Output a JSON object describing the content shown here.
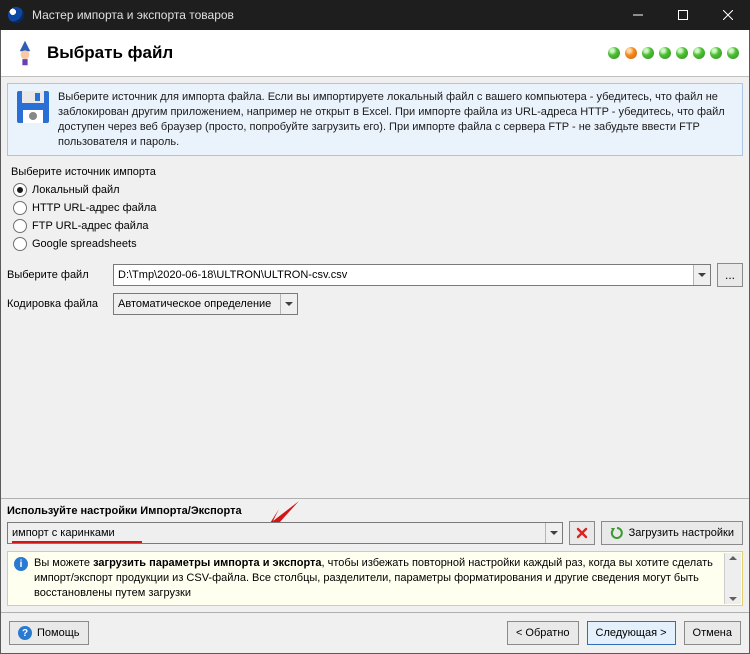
{
  "titlebar": {
    "title": "Мастер импорта и экспорта товаров"
  },
  "header": {
    "title": "Выбрать файл"
  },
  "info": {
    "text": "Выберите источник для импорта файла. Если вы импортируете локальный файл с вашего компьютера - убедитесь, что файл не заблокирован другим приложением, например не открыт в Excel. При импорте файла из URL-адреса HTTP - убедитесь, что файл доступен через веб браузер (просто, попробуйте загрузить его). При импорте файла с сервера FTP - не забудьте ввести FTP пользователя и пароль."
  },
  "source": {
    "label": "Выберите источник импорта",
    "options": {
      "local": "Локальный файл",
      "http": "HTTP URL-адрес файла",
      "ftp": "FTP URL-адрес файла",
      "gsheets": "Google spreadsheets"
    }
  },
  "file": {
    "label": "Выберите файл",
    "value": "D:\\Tmp\\2020-06-18\\ULTRON\\ULTRON-csv.csv"
  },
  "encoding": {
    "label": "Кодировка файла",
    "value": "Автоматическое определение"
  },
  "settings": {
    "title": "Используйте настройки Импорта/Экспорта",
    "preset": "импорт с каринками",
    "load_label": "Загрузить настройки"
  },
  "hint": {
    "prefix": "Вы можете ",
    "bold": "загрузить параметры импорта и экспорта",
    "rest": ", чтобы избежать повторной настройки каждый раз, когда вы хотите сделать импорт/экспорт продукции из CSV-файла. Все столбцы, разделители, параметры форматирования и другие сведения могут быть восстановлены путем загрузки"
  },
  "footer": {
    "help": "Помощь",
    "back": "< Обратно",
    "next": "Следующая >",
    "cancel": "Отмена"
  }
}
